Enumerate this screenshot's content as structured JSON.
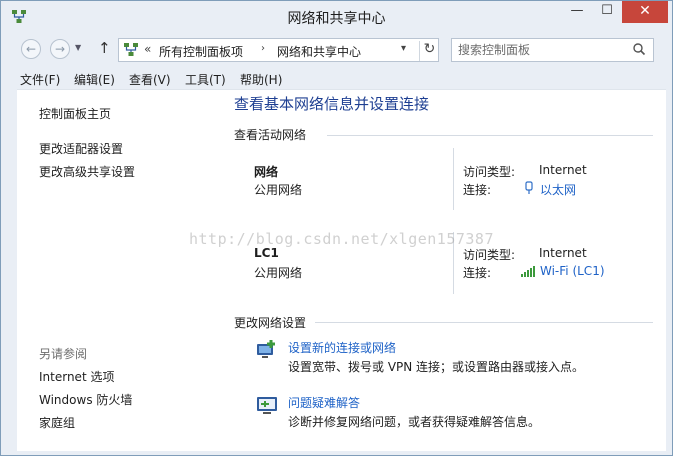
{
  "window": {
    "title": "网络和共享中心",
    "controls": {
      "minimize": "—",
      "maximize": "☐",
      "close": "✕"
    }
  },
  "address_bar": {
    "chevron": "«",
    "crumbs": [
      "所有控制面板项",
      "网络和共享中心"
    ],
    "separator": "›",
    "search_placeholder": "搜索控制面板"
  },
  "menu": [
    "文件(F)",
    "编辑(E)",
    "查看(V)",
    "工具(T)",
    "帮助(H)"
  ],
  "sidebar": {
    "top_links": [
      "控制面板主页",
      "更改适配器设置",
      "更改高级共享设置"
    ],
    "see_also_header": "另请参阅",
    "see_also_links": [
      "Internet 选项",
      "Windows 防火墙",
      "家庭组"
    ]
  },
  "main": {
    "title": "查看基本网络信息并设置连接",
    "active_networks_header": "查看活动网络",
    "networks": [
      {
        "name": "网络",
        "type": "公用网络",
        "access_label": "访问类型:",
        "access_value": "Internet",
        "conn_label": "连接:",
        "conn_value": "以太网",
        "conn_icon": "ethernet-icon"
      },
      {
        "name": "LC1",
        "type": "公用网络",
        "access_label": "访问类型:",
        "access_value": "Internet",
        "conn_label": "连接:",
        "conn_value": "Wi-Fi (LC1)",
        "conn_icon": "wifi-signal-icon"
      }
    ],
    "change_settings_header": "更改网络设置",
    "tasks": [
      {
        "link": "设置新的连接或网络",
        "desc": "设置宽带、拨号或 VPN 连接；或设置路由器或接入点。",
        "icon": "new-connection-icon"
      },
      {
        "link": "问题疑难解答",
        "desc": "诊断并修复网络问题，或者获得疑难解答信息。",
        "icon": "troubleshoot-icon"
      }
    ]
  },
  "watermark": "http://blog.csdn.net/xlgen157387",
  "colors": {
    "link": "#1e62c7",
    "title": "#1e3f92",
    "close": "#c7463b",
    "frame": "#e9eef5"
  }
}
